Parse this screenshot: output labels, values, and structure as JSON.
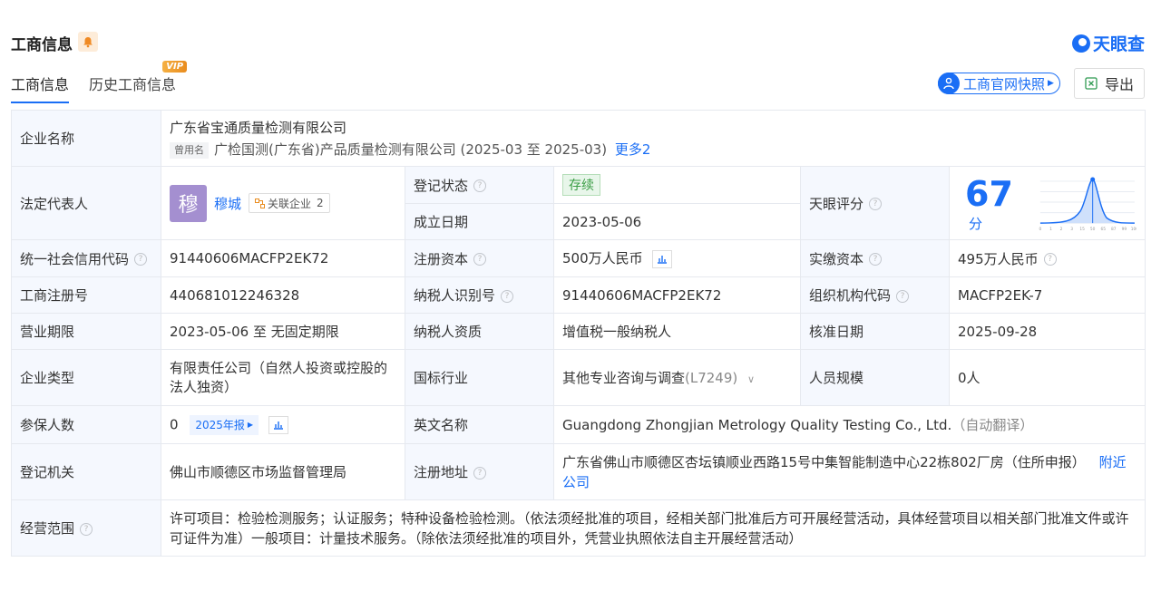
{
  "header": {
    "title": "工商信息",
    "logo_text": "天眼查"
  },
  "tabs": [
    {
      "label": "工商信息",
      "active": true
    },
    {
      "label": "历史工商信息",
      "badge": "VIP"
    }
  ],
  "toolbar": {
    "snapshot_label": "工商官网快照",
    "export_label": "导出"
  },
  "company": {
    "name_label": "企业名称",
    "name": "广东省宝通质量检测有限公司",
    "former_tag": "曾用名",
    "former_name": "广检国测(广东省)产品质量检测有限公司 (2025-03 至 2025-03)",
    "more_link": "更多2",
    "legal_rep_label": "法定代表人",
    "legal_rep_avatar": "穆",
    "legal_rep_name": "穆城",
    "related_label": "关联企业",
    "related_count": "2",
    "reg_status_label": "登记状态",
    "reg_status": "存续",
    "found_date_label": "成立日期",
    "found_date": "2023-05-06",
    "rating_label": "天眼评分",
    "rating_score": "67",
    "rating_unit": "分",
    "credit_code_label": "统一社会信用代码",
    "credit_code": "91440606MACFP2EK72",
    "reg_capital_label": "注册资本",
    "reg_capital": "500万人民币",
    "paid_capital_label": "实缴资本",
    "paid_capital": "495万人民币",
    "biz_reg_no_label": "工商注册号",
    "biz_reg_no": "440681012246328",
    "taxpayer_id_label": "纳税人识别号",
    "taxpayer_id": "91440606MACFP2EK72",
    "org_code_label": "组织机构代码",
    "org_code": "MACFP2EK-7",
    "term_label": "营业期限",
    "term": "2023-05-06 至 无固定期限",
    "taxpayer_qual_label": "纳税人资质",
    "taxpayer_qual": "增值税一般纳税人",
    "approval_date_label": "核准日期",
    "approval_date": "2025-09-28",
    "type_label": "企业类型",
    "type": "有限责任公司（自然人投资或控股的法人独资）",
    "industry_label": "国标行业",
    "industry": "其他专业咨询与调查",
    "industry_code": "(L7249)",
    "staff_size_label": "人员规模",
    "staff_size": "0人",
    "insured_label": "参保人数",
    "insured": "0",
    "insured_year": "2025年报",
    "english_name_label": "英文名称",
    "english_name": "Guangdong Zhongjian Metrology Quality Testing Co., Ltd.",
    "auto_translate": "（自动翻译）",
    "authority_label": "登记机关",
    "authority": "佛山市顺德区市场监督管理局",
    "address_label": "注册地址",
    "address": "广东省佛山市顺德区杏坛镇顺业西路15号中集智能制造中心22栋802厂房（住所申报）",
    "nearby_link": "附近公司",
    "scope_label": "经营范围",
    "scope": "许可项目：检验检测服务；认证服务；特种设备检验检测。（依法须经批准的项目，经相关部门批准后方可开展经营活动，具体经营项目以相关部门批准文件或许可证件为准）一般项目：计量技术服务。（除依法须经批准的项目外，凭营业执照依法自主开展经营活动）"
  },
  "rating_chart": {
    "ticks": [
      "0",
      "1",
      "2",
      "3",
      "15",
      "50",
      "65",
      "87",
      "99",
      "100"
    ]
  },
  "colors": {
    "accent": "#1a6ef5",
    "label_bg": "#f5f8fe",
    "status_green": "#3a9d44"
  }
}
